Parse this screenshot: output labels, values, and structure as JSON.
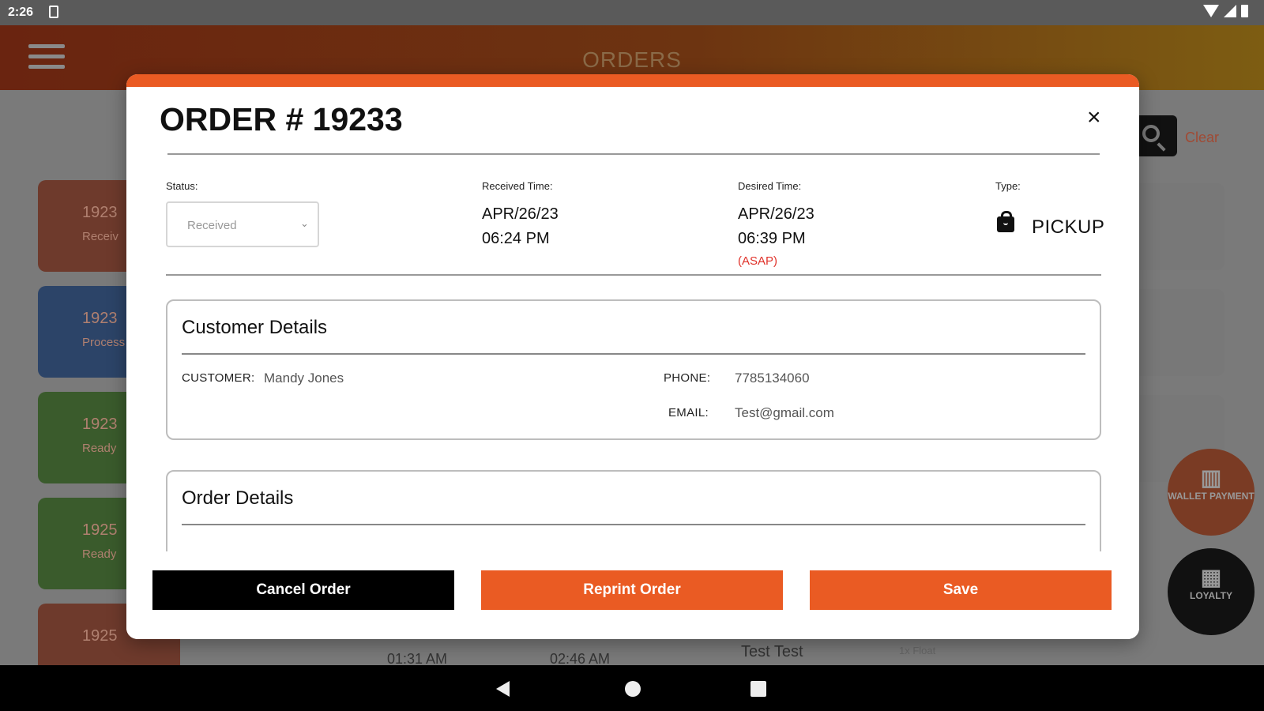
{
  "status_bar": {
    "time": "2:26"
  },
  "app_bar": {
    "title": "ORDERS"
  },
  "background": {
    "search_clear": "Clear",
    "cards": [
      {
        "number": "1923",
        "status": "Receiv",
        "color": "#6e3a2c"
      },
      {
        "number": "1923",
        "status": "Process",
        "color": "#2c4468"
      },
      {
        "number": "1923",
        "status": "Ready",
        "color": "#3a5b2c"
      },
      {
        "number": "1925",
        "status": "Ready",
        "color": "#3a5b2c"
      },
      {
        "number": "1925",
        "status": "",
        "color": "#6e3a2c"
      }
    ],
    "bottom_row": {
      "time1": "01:31 AM",
      "time2": "02:46 AM",
      "customer": "Test Test",
      "items": "1x Float"
    },
    "fab_wallet": "WALLET PAYMENT",
    "fab_loyalty": "LOYALTY"
  },
  "modal": {
    "title": "ORDER # 19233",
    "close_label": "×",
    "status_label": "Status:",
    "status_value": "Received",
    "received_label": "Received Time:",
    "received_date": "APR/26/23",
    "received_time": "06:24 PM",
    "desired_label": "Desired Time:",
    "desired_date": "APR/26/23",
    "desired_time": "06:39 PM",
    "desired_note": "(ASAP)",
    "type_label": "Type:",
    "type_value": "PICKUP",
    "customer_details": {
      "title": "Customer Details",
      "customer_label": "CUSTOMER:",
      "customer_value": "Mandy Jones",
      "phone_label": "PHONE:",
      "phone_value": "7785134060",
      "email_label": "EMAIL:",
      "email_value": "Test@gmail.com"
    },
    "order_details": {
      "title": "Order Details"
    },
    "buttons": {
      "cancel": "Cancel Order",
      "reprint": "Reprint Order",
      "save": "Save"
    }
  },
  "colors": {
    "accent": "#ea5b23",
    "asap": "#e0322a"
  }
}
